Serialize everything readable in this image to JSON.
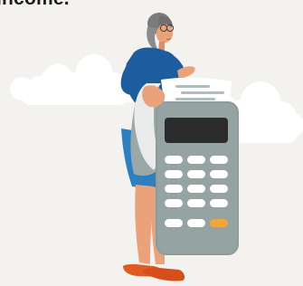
{
  "heading": {
    "text": "income."
  },
  "colors": {
    "background": "#f4f2ef",
    "cloud": "#ffffff",
    "calculator_body": "#8e9b9a",
    "calculator_display": "#2b2b2b",
    "calculator_key": "#ffffff",
    "calculator_key_accent": "#f0a63a",
    "shirt": "#1d5d9e",
    "apron": "#9aa9a8",
    "skirt": "#2d7fc0",
    "skin": "#e9a27a",
    "hair": "#7b7b7b",
    "shoes": "#e05a22",
    "receipt": "#ffffff"
  },
  "illustration": {
    "subject": "woman-with-calculator-printing-receipt"
  }
}
